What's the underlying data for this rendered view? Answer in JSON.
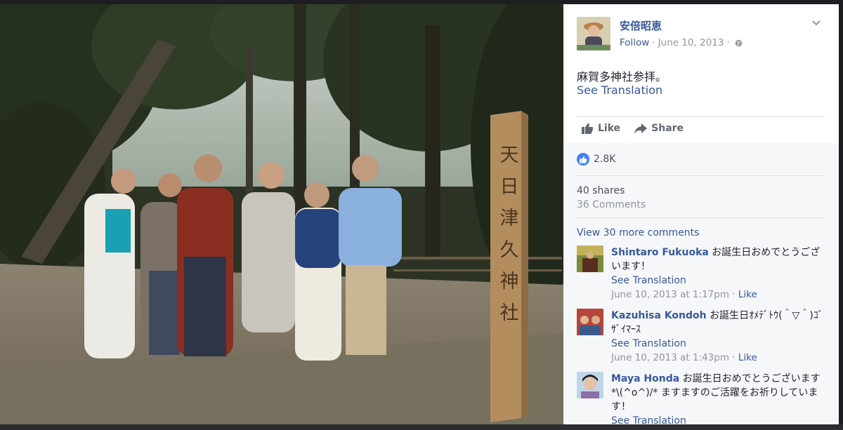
{
  "post": {
    "author": "安倍昭恵",
    "follow": "Follow",
    "separator": "·",
    "date": "June 10, 2013",
    "text": "麻賀多神社参拝。",
    "see_translation": "See Translation"
  },
  "actions": {
    "like": "Like",
    "share": "Share"
  },
  "stats": {
    "reactions": "2.8K",
    "shares": "40 shares",
    "comments": "36 Comments",
    "view_more": "View 30 more comments"
  },
  "shrine_post_text": "天日津久神社",
  "comments": [
    {
      "name": "Shintaro Fukuoka",
      "text": "お誕生日おめでとうございます！",
      "see_translation": "See Translation",
      "time": "June 10, 2013 at 1:17pm",
      "like": "Like"
    },
    {
      "name": "Kazuhisa Kondoh",
      "text": "お誕生日ｵﾒﾃﾞﾄｳ(＾▽＾)ｺﾞｻﾞｲﾏｰｽ",
      "see_translation": "See Translation",
      "time": "June 10, 2013 at 1:43pm",
      "like": "Like"
    },
    {
      "name": "Maya Honda",
      "text": "お誕生日おめでとうございます*\\(^o^)/* ますますのご活躍をお祈りしています！",
      "see_translation": "See Translation"
    }
  ],
  "colors": {
    "link": "#365899",
    "like_blue": "#4080ff",
    "muted": "#90949c"
  }
}
